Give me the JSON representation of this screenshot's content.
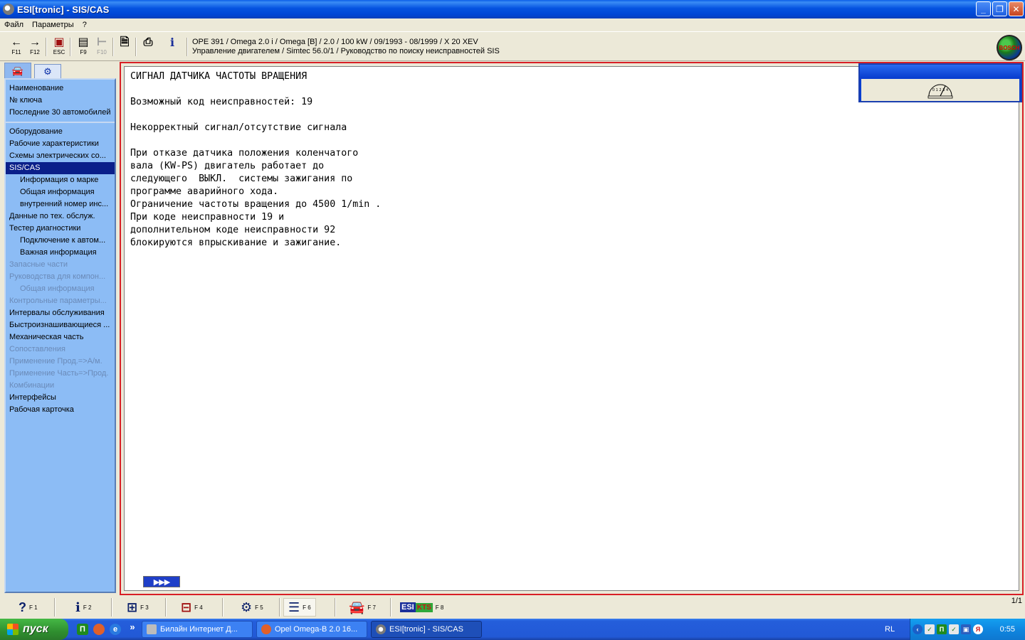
{
  "window": {
    "title": "ESI[tronic] - SIS/CAS",
    "minimize": "_",
    "maximize": "❐",
    "close": "✕"
  },
  "menu": [
    "Файл",
    "Параметры",
    "?"
  ],
  "toolbar": {
    "back_key": "F11",
    "forward_key": "F12",
    "esc_key": "ESC",
    "f9_key": "F9",
    "f10_key": "F10",
    "vehicle_line1": "OPE 391 / Omega 2.0 i / Omega [B] / 2.0 / 100 kW / 09/1993 - 08/1999 / X 20 XEV",
    "vehicle_line2": "Управление двигателем / Simtec 56.0/1 / Руководство по поиску неисправностей SIS",
    "logo_text": "BOSCH"
  },
  "sidebar": {
    "group1": [
      "Наименование",
      "№ ключа",
      "Последние 30 автомобилей"
    ],
    "group2": [
      {
        "label": "Оборудование",
        "sub": false,
        "disabled": false,
        "selected": false
      },
      {
        "label": "Рабочие характеристики",
        "sub": false,
        "disabled": false,
        "selected": false
      },
      {
        "label": "Схемы электрических со...",
        "sub": false,
        "disabled": false,
        "selected": false
      },
      {
        "label": "SIS/CAS",
        "sub": false,
        "disabled": false,
        "selected": true
      },
      {
        "label": "Информация о марке",
        "sub": true,
        "disabled": false,
        "selected": false
      },
      {
        "label": "Общая информация",
        "sub": true,
        "disabled": false,
        "selected": false
      },
      {
        "label": "внутренний номер инс...",
        "sub": true,
        "disabled": false,
        "selected": false
      },
      {
        "label": "Данные по тех. обслуж.",
        "sub": false,
        "disabled": false,
        "selected": false
      },
      {
        "label": "Тестер диагностики",
        "sub": false,
        "disabled": false,
        "selected": false
      },
      {
        "label": "Подключение к автом...",
        "sub": true,
        "disabled": false,
        "selected": false
      },
      {
        "label": "Важная информация",
        "sub": true,
        "disabled": false,
        "selected": false
      },
      {
        "label": "Запасные части",
        "sub": false,
        "disabled": true,
        "selected": false
      },
      {
        "label": "Руководства для компон...",
        "sub": false,
        "disabled": true,
        "selected": false
      },
      {
        "label": "Общая информация",
        "sub": true,
        "disabled": true,
        "selected": false
      },
      {
        "label": "Контрольные параметры...",
        "sub": false,
        "disabled": true,
        "selected": false
      },
      {
        "label": "Интервалы обслуживания",
        "sub": false,
        "disabled": false,
        "selected": false
      },
      {
        "label": "Быстроизнашивающиеся ...",
        "sub": false,
        "disabled": false,
        "selected": false
      },
      {
        "label": "Механическая часть",
        "sub": false,
        "disabled": false,
        "selected": false
      },
      {
        "label": "Сопоставления",
        "sub": false,
        "disabled": true,
        "selected": false
      },
      {
        "label": "Применение Прод.=>А/м.",
        "sub": false,
        "disabled": true,
        "selected": false
      },
      {
        "label": "Применение Часть=>Прод.",
        "sub": false,
        "disabled": true,
        "selected": false
      },
      {
        "label": "Комбинации",
        "sub": false,
        "disabled": true,
        "selected": false
      },
      {
        "label": "Интерфейсы",
        "sub": false,
        "disabled": false,
        "selected": false
      },
      {
        "label": "Рабочая карточка",
        "sub": false,
        "disabled": false,
        "selected": false
      }
    ]
  },
  "document": {
    "lines": [
      "СИГНАЛ ДАТЧИКА ЧАСТОТЫ ВРАЩЕНИЯ",
      "",
      "Возможный код неисправностей: 19",
      "",
      "Некорректный сигнал/отсутствие сигнала",
      "",
      "При отказе датчика положения коленчатого",
      "вала (KW-PS) двигатель работает до",
      "следующего  ВЫКЛ.  системы зажигания по",
      "программе аварийного хода.",
      "Ограничение частоты вращения до 4500 1/min .",
      "При коде неисправности 19 и",
      "дополнительном коде неисправности 92",
      "блокируются впрыскивание и зажигание."
    ],
    "next_label": "▶▶▶",
    "meter_scale": "0 1 2 3 4"
  },
  "fkeys": [
    {
      "icon": "?",
      "key": "F 1"
    },
    {
      "icon": "i",
      "key": "F 2"
    },
    {
      "icon": "⊞",
      "key": "F 3"
    },
    {
      "icon": "⊟",
      "key": "F 4"
    },
    {
      "icon": "⚙",
      "key": "F 5"
    },
    {
      "icon": "☰",
      "key": "F 6"
    },
    {
      "icon": "🚘",
      "key": "F 7"
    },
    {
      "icon": "ESI",
      "key": "F 8"
    }
  ],
  "page_count": "1/1",
  "taskbar": {
    "start": "пуск",
    "ql_more": "»",
    "tasks": [
      "Билайн Интернет Д...",
      "Opel Omega-B 2.0 16...",
      "ESI[tronic] - SIS/CAS"
    ],
    "lang": "RL",
    "clock": "0:55"
  }
}
